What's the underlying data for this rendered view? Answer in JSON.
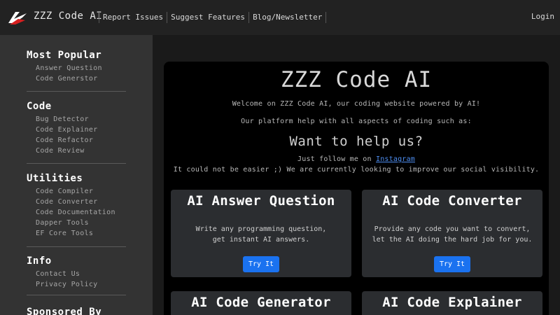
{
  "nav": {
    "brand": "ZZZ Code AI",
    "links": [
      "Report Issues",
      "Suggest Features",
      "Blog/Newsletter"
    ],
    "login": "Login"
  },
  "sidebar": {
    "sections": [
      {
        "title": "Most Popular",
        "items": [
          "Answer Question",
          "Code Generstor"
        ]
      },
      {
        "title": "Code",
        "items": [
          "Bug Detector",
          "Code Explainer",
          "Code Refactor",
          "Code Review"
        ]
      },
      {
        "title": "Utilities",
        "items": [
          "Code Compiler",
          "Code Converter",
          "Code Documentation",
          "Dapper Tools",
          "EF Core Tools"
        ]
      },
      {
        "title": "Info",
        "items": [
          "Contact Us",
          "Privacy Policy"
        ]
      },
      {
        "title": "Sponsored By",
        "items": []
      }
    ]
  },
  "main": {
    "title": "ZZZ Code AI",
    "welcome": "Welcome on ZZZ Code AI, our coding website powered by AI!",
    "platform": "Our platform help with all aspects of coding such as:",
    "help_title": "Want to help us?",
    "follow_prefix": "Just follow me on ",
    "follow_link": "Instagram",
    "visibility": "It could not be easier ;) We are currently looking to improve our social visibility."
  },
  "cards": [
    {
      "title": "AI Answer Question",
      "desc1": "Write any programming question,",
      "desc2": "get instant AI answers.",
      "button": "Try It"
    },
    {
      "title": "AI Code Converter",
      "desc1": "Provide any code you want to convert,",
      "desc2": "let the AI doing the hard job for you.",
      "button": "Try It"
    },
    {
      "title": "AI Code Generator"
    },
    {
      "title": "AI Code Explainer"
    }
  ],
  "colors": {
    "accent": "#1a72f0",
    "link": "#4d8df0"
  }
}
